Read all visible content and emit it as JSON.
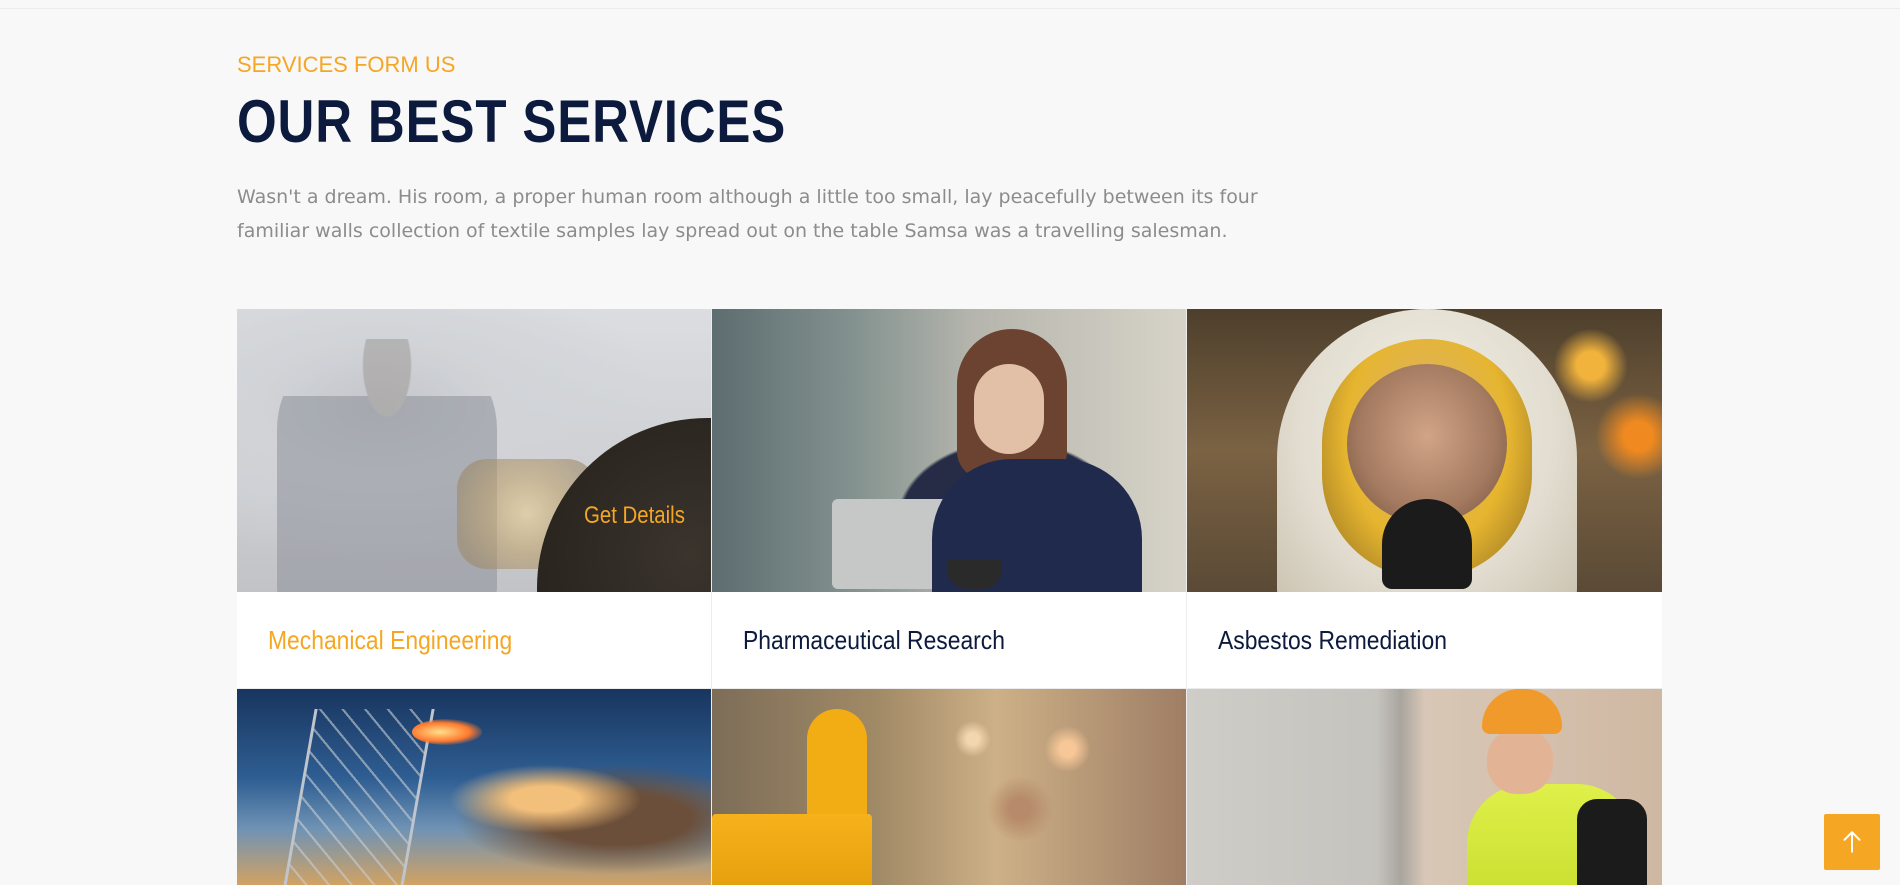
{
  "section": {
    "eyebrow": "SERVICES FORM US",
    "title": "OUR BEST SERVICES",
    "description": "Wasn't a dream. His room, a proper human room although a little too small, lay peacefully between its four familiar walls collection of textile samples lay spread out on the table Samsa was a travelling salesman."
  },
  "services": [
    {
      "title": "Mechanical Engineering",
      "active": true,
      "cta": "Get Details"
    },
    {
      "title": "Pharmaceutical Research",
      "active": false
    },
    {
      "title": "Asbestos Remediation",
      "active": false
    }
  ],
  "back_to_top": {
    "icon": "arrow-up-icon"
  },
  "colors": {
    "accent": "#f5a623",
    "heading": "#0c1a3d",
    "body_text": "#8c8c8c",
    "background": "#f8f8f8"
  }
}
